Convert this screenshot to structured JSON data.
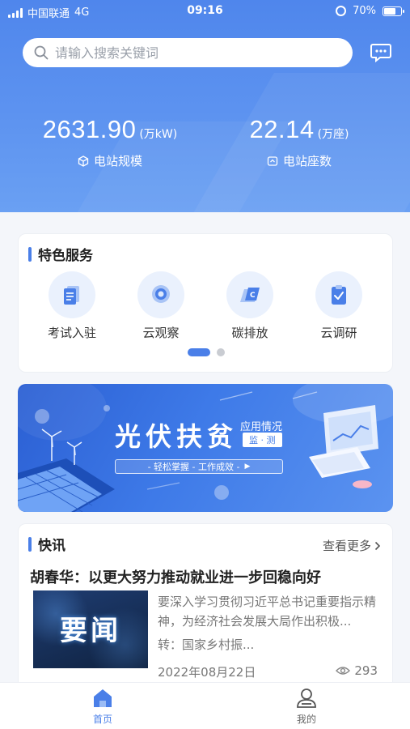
{
  "status_bar": {
    "carrier": "中国联通",
    "network": "4G",
    "time": "09:16",
    "battery": "70%",
    "battery_level": 0.7
  },
  "search": {
    "placeholder": "请输入搜索关键词"
  },
  "stats": [
    {
      "value": "2631.90",
      "unit": "(万kW)",
      "label": "电站规模",
      "icon": "cube-icon"
    },
    {
      "value": "22.14",
      "unit": "(万座)",
      "label": "电站座数",
      "icon": "station-icon"
    }
  ],
  "services": {
    "title": "特色服务",
    "items": [
      {
        "label": "考试入驻",
        "icon": "document-icon"
      },
      {
        "label": "云观察",
        "icon": "location-pin-icon"
      },
      {
        "label": "碳排放",
        "icon": "carbon-icon"
      },
      {
        "label": "云调研",
        "icon": "clipboard-check-icon"
      }
    ],
    "page_count": 2,
    "active_page": 0
  },
  "banner": {
    "title": "光伏扶贫",
    "tag_top": "应用情况",
    "tag_bottom": "监 · 测",
    "slogan": "- 轻松掌握 - 工作成效 -"
  },
  "news": {
    "title": "快讯",
    "more_label": "查看更多",
    "headline": "胡春华：以更大努力推动就业进一步回稳向好",
    "thumb_text": "要闻",
    "excerpt": "要深入学习贯彻习近平总书记重要指示精神，为经济社会发展大局作出积极...",
    "source": "转：国家乡村振...",
    "date": "2022年08月22日",
    "views": "293"
  },
  "tabbar": {
    "items": [
      {
        "label": "首页",
        "active": true
      },
      {
        "label": "我的",
        "active": false
      }
    ]
  },
  "colors": {
    "accent": "#4a7fe8",
    "hero_top": "#4f86ec",
    "hero_bottom": "#6aa0f3"
  }
}
